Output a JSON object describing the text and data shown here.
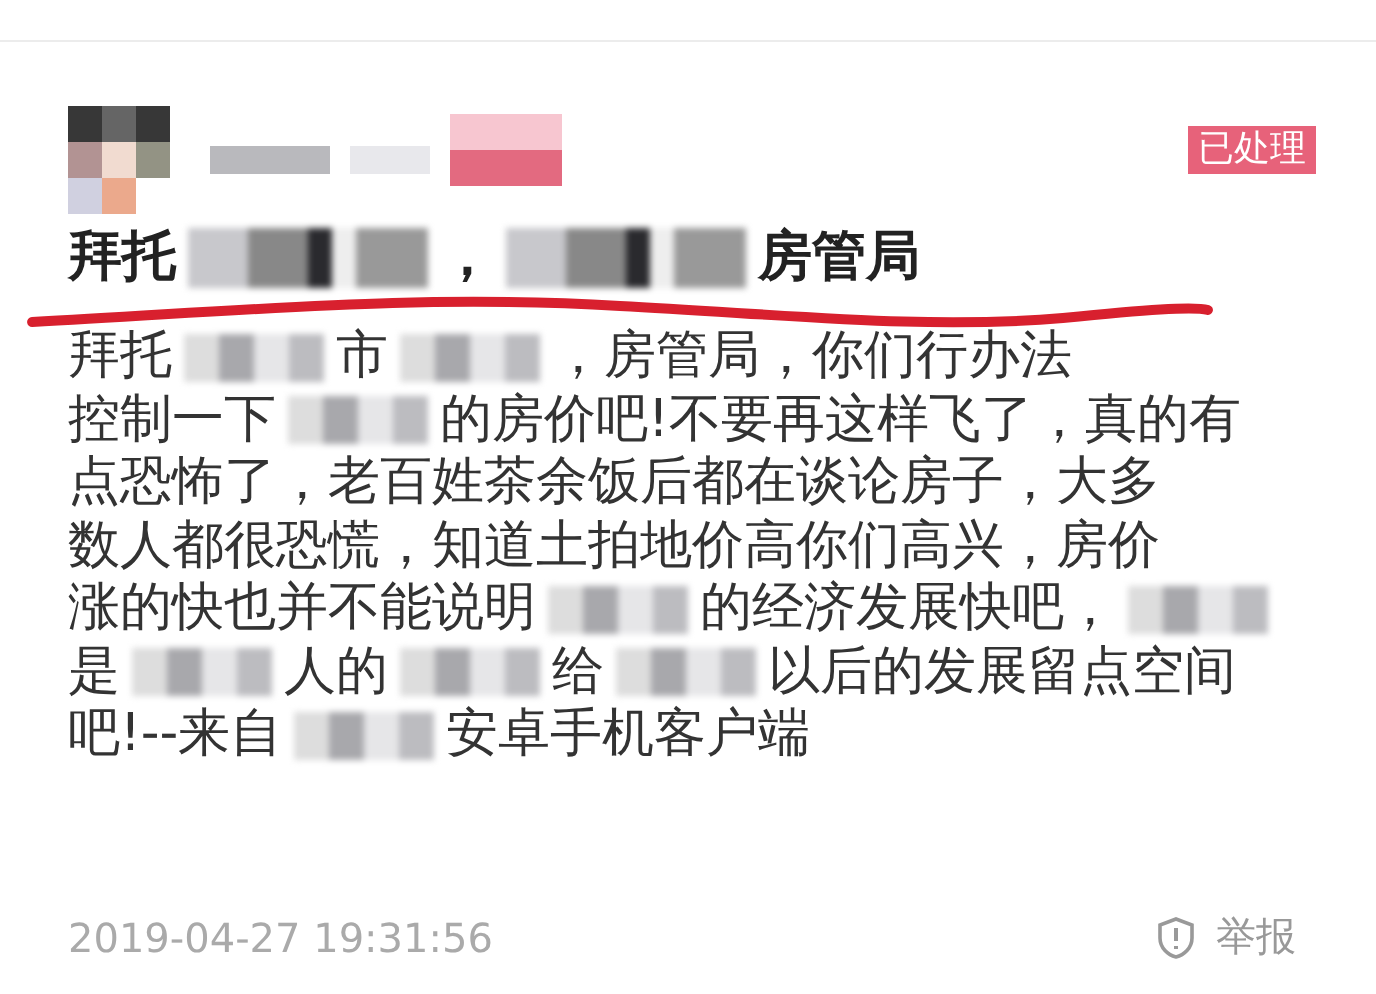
{
  "post": {
    "status_badge": "已处理",
    "title": [
      {
        "kind": "text",
        "text": "拜托"
      },
      {
        "kind": "redacted"
      },
      {
        "kind": "text",
        "text": "，"
      },
      {
        "kind": "redacted"
      },
      {
        "kind": "text",
        "text": "房管局"
      }
    ],
    "body_lines": [
      [
        {
          "kind": "text",
          "text": "拜托"
        },
        {
          "kind": "redacted"
        },
        {
          "kind": "text",
          "text": "市"
        },
        {
          "kind": "redacted"
        },
        {
          "kind": "text",
          "text": "，房管局，你们行办法"
        }
      ],
      [
        {
          "kind": "text",
          "text": "控制一下"
        },
        {
          "kind": "redacted"
        },
        {
          "kind": "text",
          "text": "的房价吧!不要再这样飞了，真的有"
        }
      ],
      [
        {
          "kind": "text",
          "text": "点恐怖了，老百姓茶余饭后都在谈论房子，大多"
        }
      ],
      [
        {
          "kind": "text",
          "text": "数人都很恐慌，知道土拍地价高你们高兴，房价"
        }
      ],
      [
        {
          "kind": "text",
          "text": "涨的快也并不能说明"
        },
        {
          "kind": "redacted"
        },
        {
          "kind": "text",
          "text": "的经济发展快吧，"
        },
        {
          "kind": "redacted"
        }
      ],
      [
        {
          "kind": "text",
          "text": "是"
        },
        {
          "kind": "redacted"
        },
        {
          "kind": "text",
          "text": "人的"
        },
        {
          "kind": "redacted"
        },
        {
          "kind": "text",
          "text": "给"
        },
        {
          "kind": "redacted"
        },
        {
          "kind": "text",
          "text": "以后的发展留点空间"
        }
      ],
      [
        {
          "kind": "text",
          "text": "吧!--来自"
        },
        {
          "kind": "redacted"
        },
        {
          "kind": "text",
          "text": "安卓手机客户端"
        }
      ]
    ],
    "timestamp": "2019-04-27 19:31:56",
    "report_link": "举报"
  }
}
